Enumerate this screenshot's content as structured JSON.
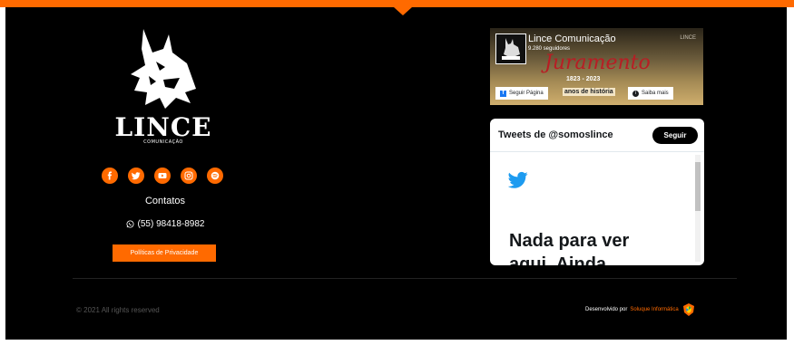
{
  "colors": {
    "accent": "#ff6a00",
    "background": "#000000"
  },
  "logo": {
    "name": "LINCE",
    "subtitle": "COMUNICAÇÃO"
  },
  "socials": [
    {
      "name": "facebook-icon"
    },
    {
      "name": "twitter-icon"
    },
    {
      "name": "youtube-icon"
    },
    {
      "name": "instagram-icon"
    },
    {
      "name": "spotify-icon"
    }
  ],
  "contacts": {
    "heading": "Contatos",
    "phone": "(55) 98418-8982"
  },
  "privacy_button": "Políticas de Privacidade",
  "facebook_widget": {
    "page_name": "Lince Comunicação",
    "followers": "9.280 seguidores",
    "banner_script": "Juramento",
    "banner_years": "1823 - 2023",
    "corner_text": "LINCE",
    "follow_label": "Seguir Página",
    "anos_label": "anos de história",
    "learn_more_label": "Saiba mais"
  },
  "twitter_widget": {
    "title": "Tweets de @somoslince",
    "follow_label": "Seguir",
    "empty_text": "Nada para ver aqui. Ainda"
  },
  "footer": {
    "copyright": "© 2021 All rights reserved",
    "developed_by": "Desenvolvido por",
    "developer_company": "Soluque Informática"
  }
}
